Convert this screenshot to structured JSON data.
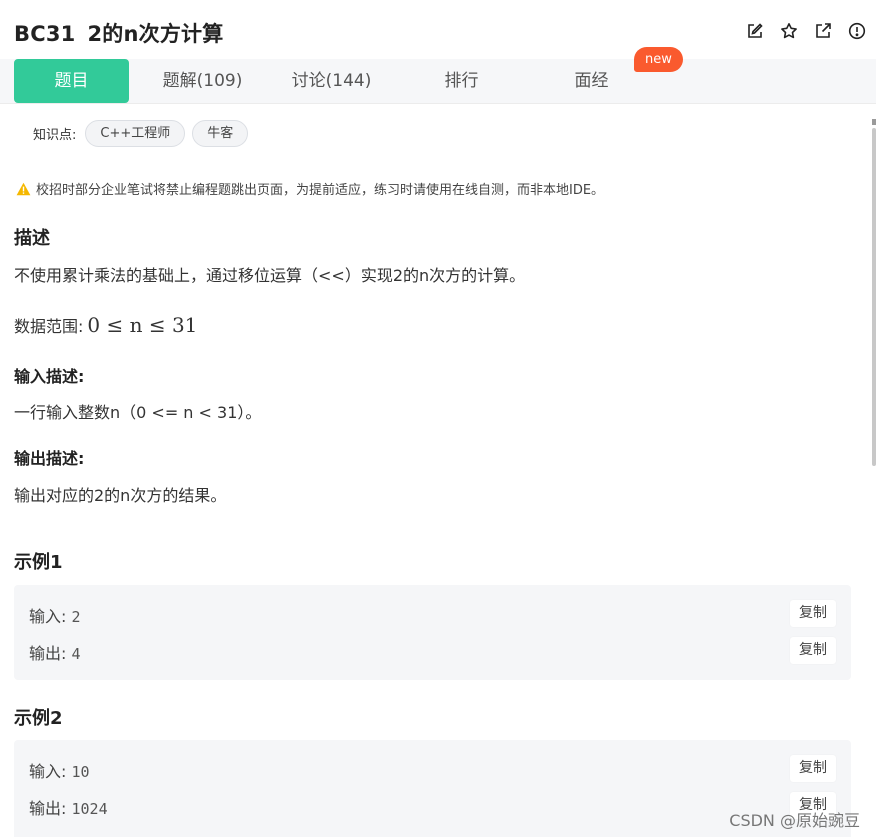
{
  "problem": {
    "code": "BC31",
    "title": "2的n次方计算"
  },
  "header_icons": [
    "edit-icon",
    "star-icon",
    "external-link-icon",
    "alert-icon"
  ],
  "tabs": [
    {
      "label": "题目"
    },
    {
      "label": "题解(109)"
    },
    {
      "label": "讨论(144)"
    },
    {
      "label": "排行"
    },
    {
      "label": "面经"
    }
  ],
  "new_badge": "new",
  "knowledge": {
    "label": "知识点:",
    "tags": [
      "C++工程师",
      "牛客"
    ]
  },
  "warning": "校招时部分企业笔试将禁止编程题跳出页面，为提前适应，练习时请使用在线自测，而非本地IDE。",
  "description": {
    "heading": "描述",
    "text": "不使用累计乘法的基础上，通过移位运算（<<）实现2的n次方的计算。",
    "range_label": "数据范围:",
    "range_math": "0 ≤ n ≤ 31"
  },
  "input_desc": {
    "heading": "输入描述:",
    "text": "一行输入整数n（0 <= n < 31）。"
  },
  "output_desc": {
    "heading": "输出描述:",
    "text": "输出对应的2的n次方的结果。"
  },
  "examples": [
    {
      "title": "示例1",
      "input_label": "输入:",
      "input": "2",
      "output_label": "输出:",
      "output": "4",
      "copy": "复制"
    },
    {
      "title": "示例2",
      "input_label": "输入:",
      "input": "10",
      "output_label": "输出:",
      "output": "1024",
      "copy": "复制"
    }
  ],
  "watermark": "CSDN @原始豌豆",
  "colors": {
    "accent": "#32ca99",
    "badge": "#fa5a2e",
    "warning": "#f5b800"
  }
}
